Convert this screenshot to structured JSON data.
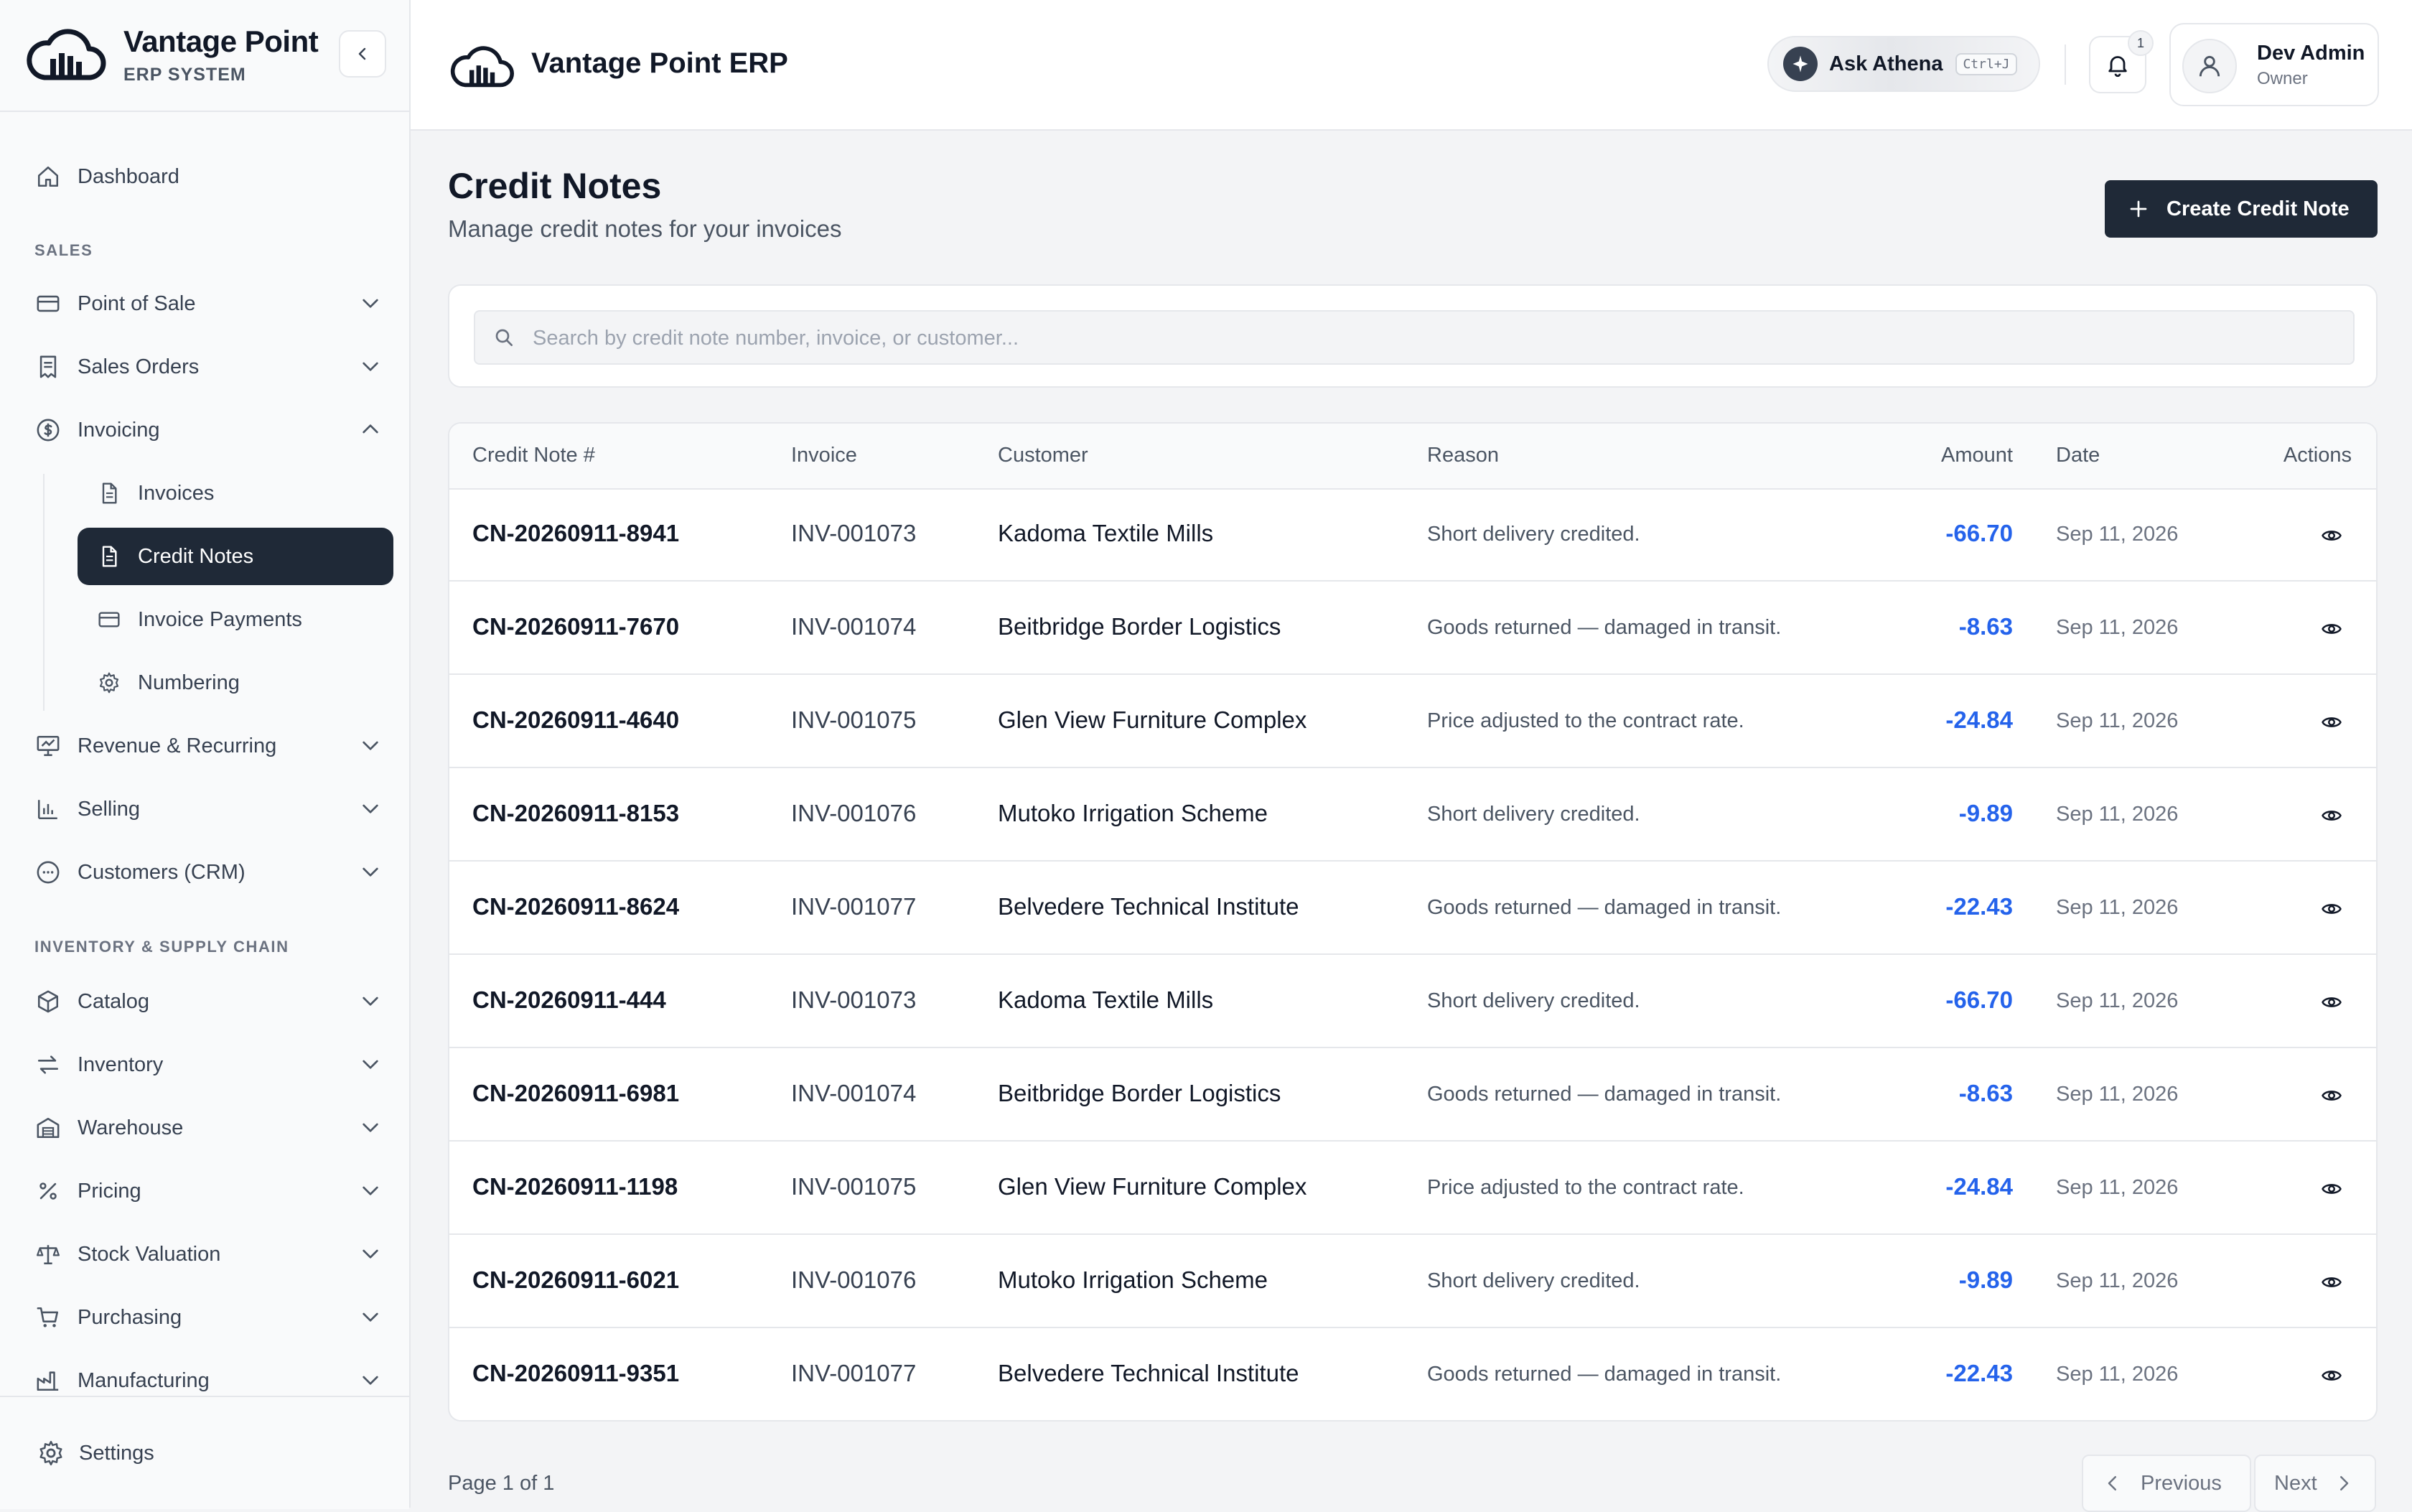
{
  "brand": {
    "name": "Vantage Point",
    "subtitle": "ERP SYSTEM",
    "logo_icon": "cloud-buildings-icon"
  },
  "sidebar": {
    "dashboard": "Dashboard",
    "section_sales": "SALES",
    "point_of_sale": "Point of Sale",
    "sales_orders": "Sales Orders",
    "invoicing": "Invoicing",
    "invoicing_sub": {
      "invoices": "Invoices",
      "credit_notes": "Credit Notes",
      "invoice_payments": "Invoice Payments",
      "numbering": "Numbering"
    },
    "revenue_recurring": "Revenue & Recurring",
    "selling": "Selling",
    "customers_crm": "Customers (CRM)",
    "section_inventory": "INVENTORY & SUPPLY CHAIN",
    "catalog": "Catalog",
    "inventory": "Inventory",
    "warehouse": "Warehouse",
    "pricing": "Pricing",
    "stock_valuation": "Stock Valuation",
    "purchasing": "Purchasing",
    "manufacturing": "Manufacturing",
    "settings": "Settings",
    "active_item": "Credit Notes"
  },
  "topbar": {
    "title": "Vantage Point ERP",
    "athena_label": "Ask Athena",
    "athena_shortcut": "Ctrl+J",
    "notification_count": "1",
    "user_name": "Dev Admin",
    "user_role": "Owner"
  },
  "page": {
    "title": "Credit Notes",
    "subtitle": "Manage credit notes for your invoices",
    "create_button": "Create Credit Note",
    "search_placeholder": "Search by credit note number, invoice, or customer..."
  },
  "table": {
    "headers": {
      "credit_note": "Credit Note #",
      "invoice": "Invoice",
      "customer": "Customer",
      "reason": "Reason",
      "amount": "Amount",
      "date": "Date",
      "actions": "Actions"
    },
    "rows": [
      {
        "credit_note": "CN-20260911-8941",
        "invoice": "INV-001073",
        "customer": "Kadoma Textile Mills",
        "reason": "Short delivery credited.",
        "amount": "-66.70",
        "date": "Sep 11, 2026"
      },
      {
        "credit_note": "CN-20260911-7670",
        "invoice": "INV-001074",
        "customer": "Beitbridge Border Logistics",
        "reason": "Goods returned — damaged in transit.",
        "amount": "-8.63",
        "date": "Sep 11, 2026"
      },
      {
        "credit_note": "CN-20260911-4640",
        "invoice": "INV-001075",
        "customer": "Glen View Furniture Complex",
        "reason": "Price adjusted to the contract rate.",
        "amount": "-24.84",
        "date": "Sep 11, 2026"
      },
      {
        "credit_note": "CN-20260911-8153",
        "invoice": "INV-001076",
        "customer": "Mutoko Irrigation Scheme",
        "reason": "Short delivery credited.",
        "amount": "-9.89",
        "date": "Sep 11, 2026"
      },
      {
        "credit_note": "CN-20260911-8624",
        "invoice": "INV-001077",
        "customer": "Belvedere Technical Institute",
        "reason": "Goods returned — damaged in transit.",
        "amount": "-22.43",
        "date": "Sep 11, 2026"
      },
      {
        "credit_note": "CN-20260911-444",
        "invoice": "INV-001073",
        "customer": "Kadoma Textile Mills",
        "reason": "Short delivery credited.",
        "amount": "-66.70",
        "date": "Sep 11, 2026"
      },
      {
        "credit_note": "CN-20260911-6981",
        "invoice": "INV-001074",
        "customer": "Beitbridge Border Logistics",
        "reason": "Goods returned — damaged in transit.",
        "amount": "-8.63",
        "date": "Sep 11, 2026"
      },
      {
        "credit_note": "CN-20260911-1198",
        "invoice": "INV-001075",
        "customer": "Glen View Furniture Complex",
        "reason": "Price adjusted to the contract rate.",
        "amount": "-24.84",
        "date": "Sep 11, 2026"
      },
      {
        "credit_note": "CN-20260911-6021",
        "invoice": "INV-001076",
        "customer": "Mutoko Irrigation Scheme",
        "reason": "Short delivery credited.",
        "amount": "-9.89",
        "date": "Sep 11, 2026"
      },
      {
        "credit_note": "CN-20260911-9351",
        "invoice": "INV-001077",
        "customer": "Belvedere Technical Institute",
        "reason": "Goods returned — damaged in transit.",
        "amount": "-22.43",
        "date": "Sep 11, 2026"
      }
    ]
  },
  "pagination": {
    "page_info": "Page 1 of 1",
    "previous": "Previous",
    "next": "Next"
  },
  "colors": {
    "accent_dark": "#1f2937",
    "amount_blue": "#2563eb",
    "border": "#e5e7eb"
  }
}
